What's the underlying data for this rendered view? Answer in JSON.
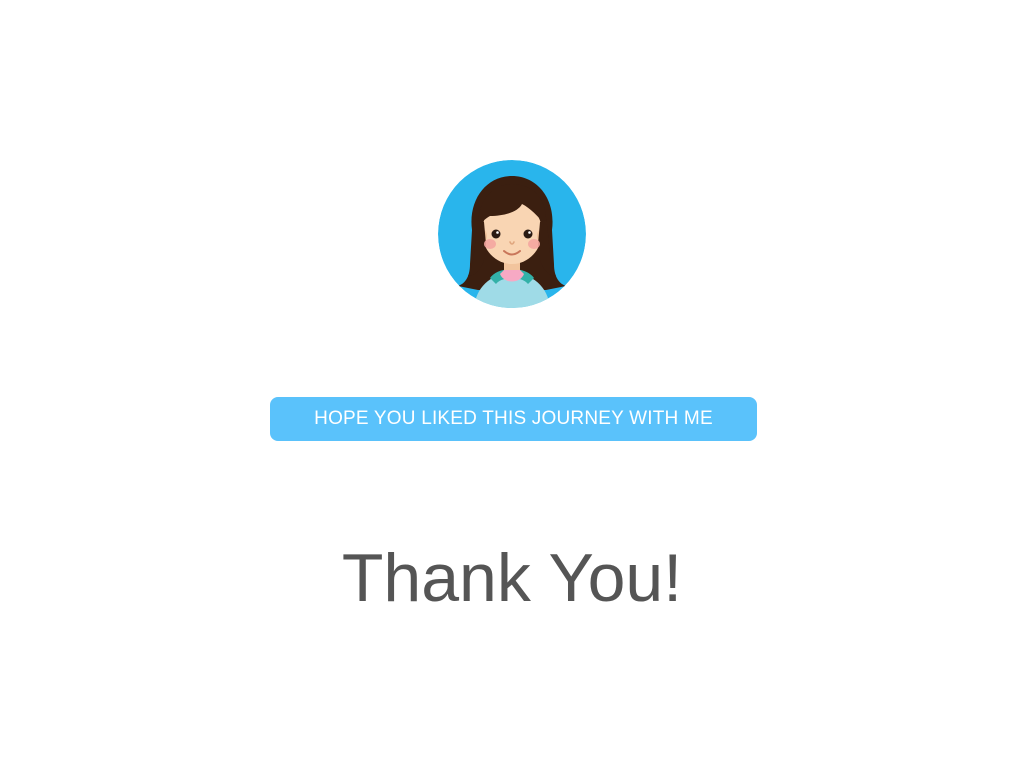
{
  "colors": {
    "background": "#ffffff",
    "avatar_circle": "#29b5ec",
    "banner_background": "#5ac2fb",
    "banner_text": "#ffffff",
    "heading_text": "#555555",
    "hair": "#3b1f10",
    "skin": "#f9d5b3",
    "cheeks": "#f4a6a0",
    "hoodie": "#9fdbe7",
    "hoodie_collar": "#33b1a8",
    "shirt": "#f7a9c4"
  },
  "avatar": {
    "icon": "girl-avatar-icon"
  },
  "banner": {
    "text": "HOPE YOU LIKED THIS JOURNEY WITH ME"
  },
  "heading": {
    "text": "Thank You!"
  }
}
